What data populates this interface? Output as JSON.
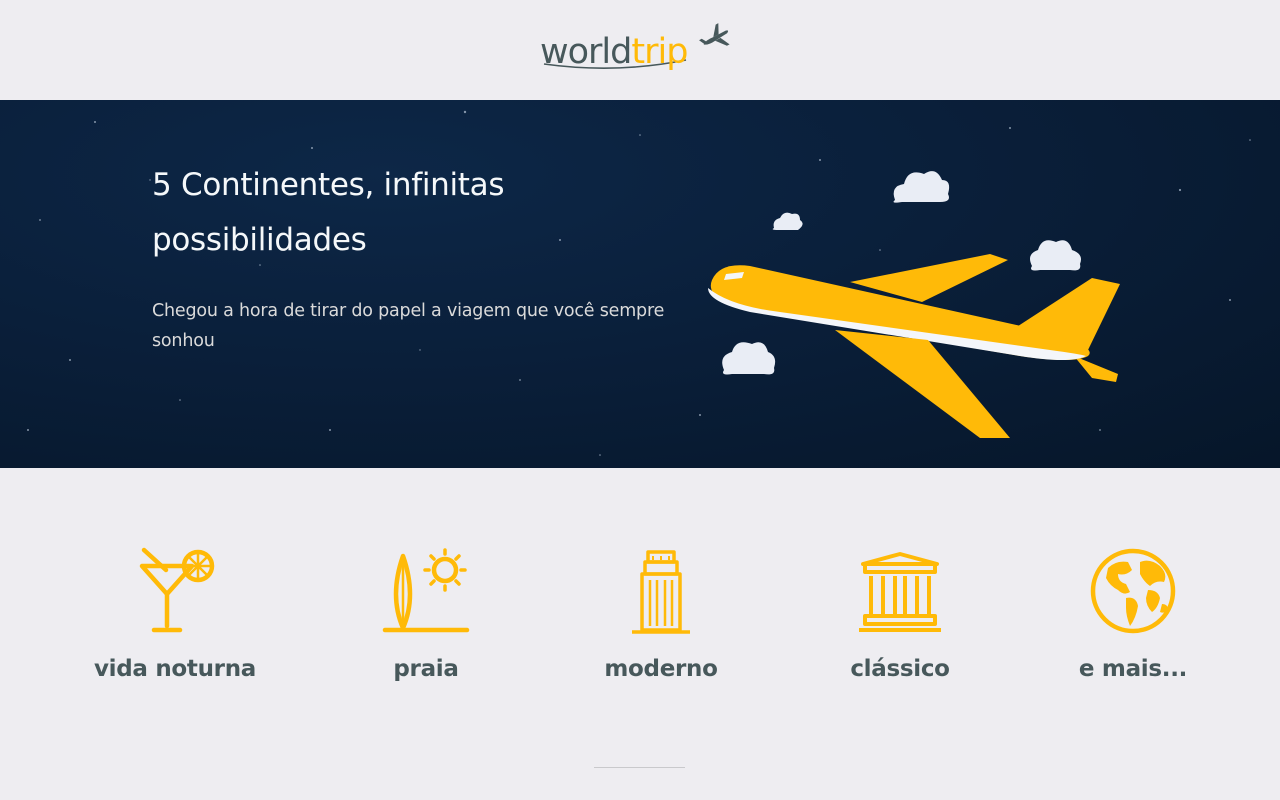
{
  "header": {
    "logo_world": "world",
    "logo_trip": "trip",
    "logo_icon": "airplane-icon"
  },
  "banner": {
    "title": "5 Continentes, infinitas possibilidades",
    "subtitle": "Chegou a hora de tirar do papel a viagem que você sempre sonhou",
    "illustration": "airplane-with-clouds"
  },
  "travel_types": [
    {
      "label": "vida noturna",
      "icon": "cocktail-icon"
    },
    {
      "label": "praia",
      "icon": "surfboard-sun-icon"
    },
    {
      "label": "moderno",
      "icon": "skyscraper-icon"
    },
    {
      "label": "clássico",
      "icon": "museum-icon"
    },
    {
      "label": "e mais...",
      "icon": "globe-icon"
    }
  ],
  "colors": {
    "brand_yellow": "#ffba08",
    "text_dark": "#47585b",
    "banner_bg": "#0a1f3a",
    "page_bg": "#eeedf1",
    "banner_text": "#f5f8fa"
  }
}
